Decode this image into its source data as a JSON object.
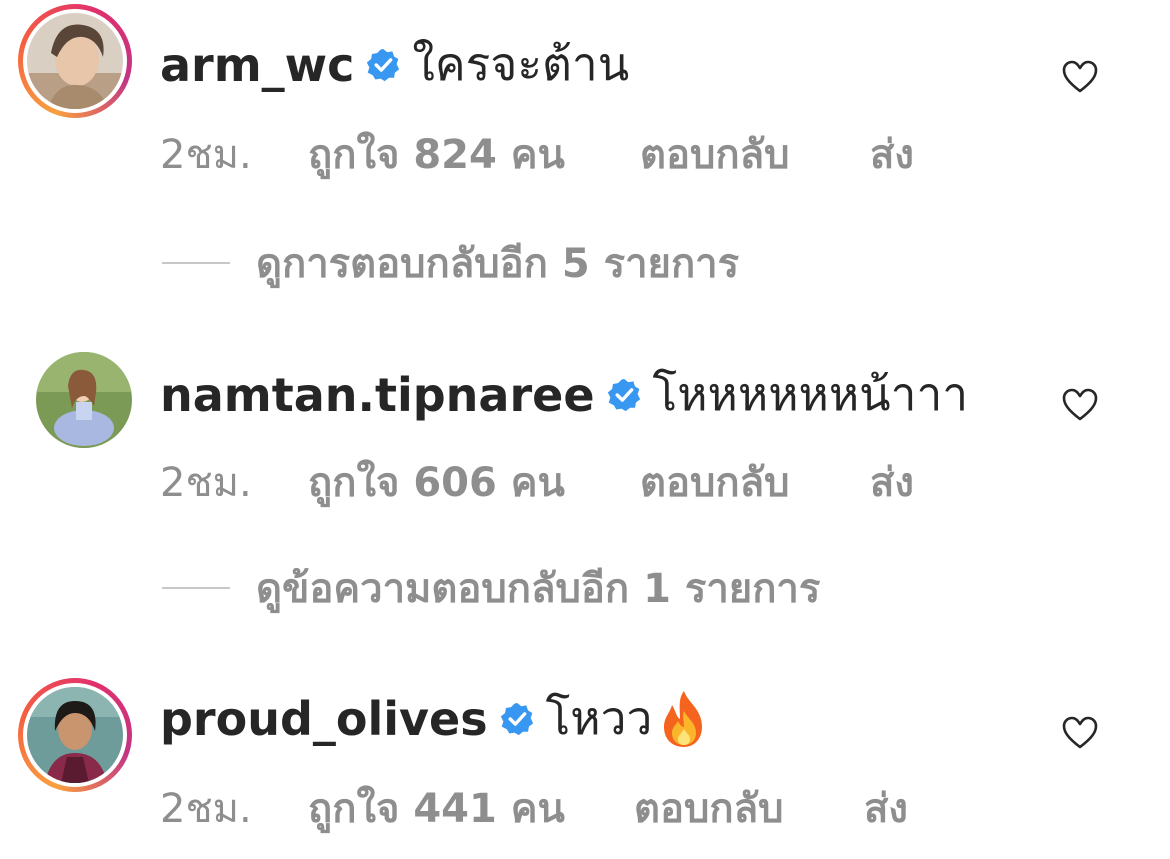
{
  "comments": [
    {
      "username": "arm_wc",
      "text": "ใครจะต้าน",
      "time": "2ชม.",
      "likes": "ถูกใจ 824 คน",
      "reply": "ตอบกลับ",
      "send": "ส่ง",
      "has_story": true,
      "view_replies": "ดูการตอบกลับอีก 5 รายการ"
    },
    {
      "username": "namtan.tipnaree",
      "text": "โหหหหหหน้าาา",
      "time": "2ชม.",
      "likes": "ถูกใจ 606 คน",
      "reply": "ตอบกลับ",
      "send": "ส่ง",
      "has_story": false,
      "view_replies": "ดูข้อความตอบกลับอีก 1 รายการ"
    },
    {
      "username": "proud_olives",
      "text": "โหวว",
      "time": "2ชม.",
      "likes": "ถูกใจ 441 คน",
      "reply": "ตอบกลับ",
      "send": "ส่ง",
      "has_story": true,
      "emoji": "fire-emoji"
    }
  ],
  "colors": {
    "text": "#262626",
    "secondary": "#8e8e8e",
    "verified": "#3897f0",
    "story_ring": [
      "#f9a03f",
      "#f56040",
      "#e1306c",
      "#c13584"
    ]
  },
  "icons": [
    "verified-badge-icon",
    "heart-icon",
    "fire-emoji"
  ]
}
